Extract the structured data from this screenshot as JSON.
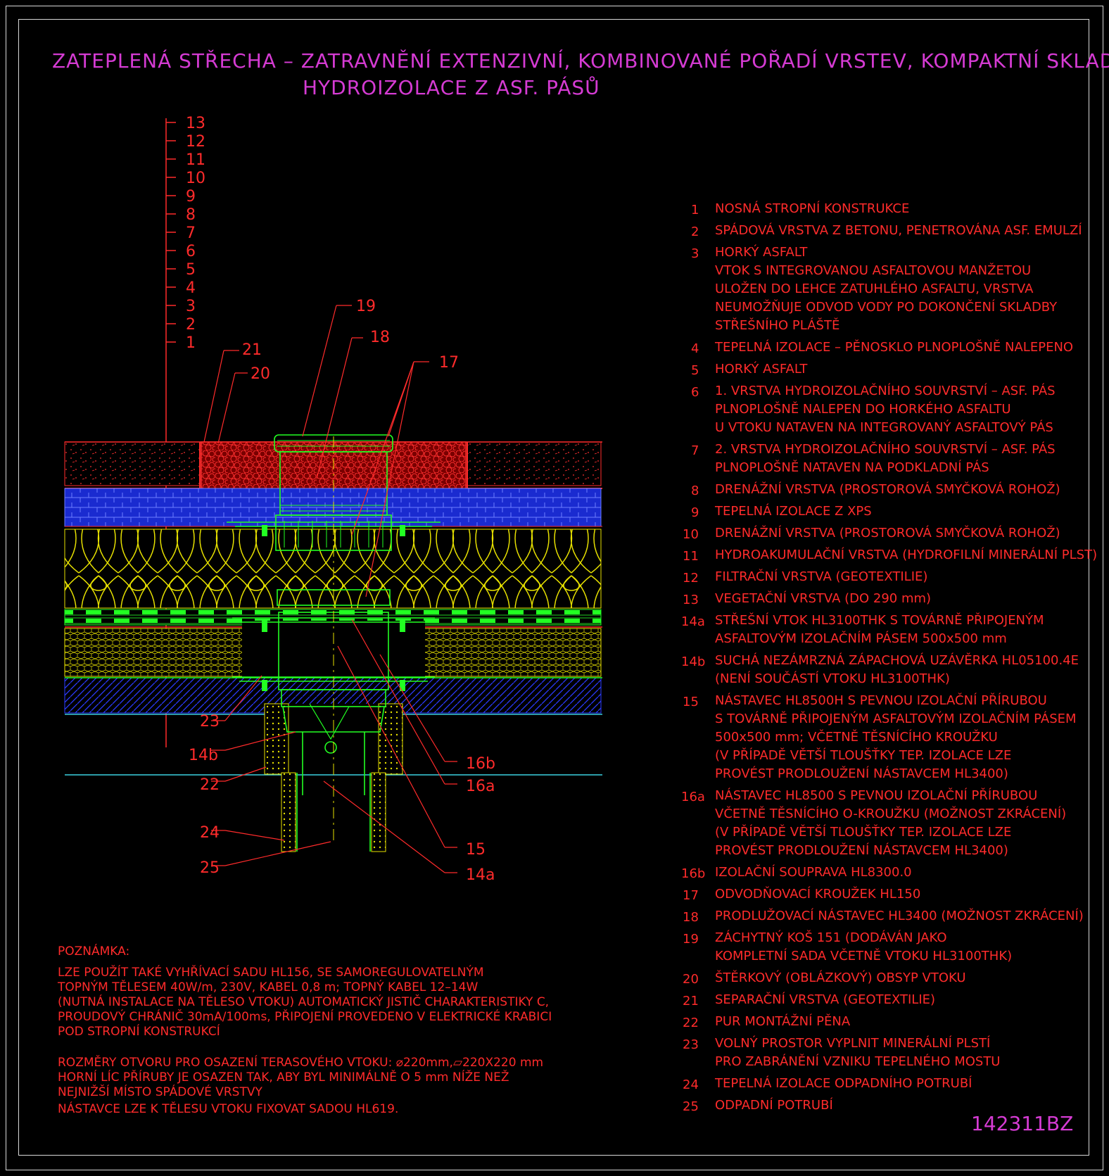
{
  "title": {
    "line1": "ZATEPLENÁ STŘECHA – ZATRAVNĚNÍ EXTENZIVNÍ, KOMBINOVANÉ POŘADÍ VRSTEV, KOMPAKTNÍ SKLADBA",
    "line2": "HYDROIZOLACE Z ASF. PÁSŮ"
  },
  "scale_labels": [
    "13",
    "12",
    "11",
    "10",
    "9",
    "8",
    "7",
    "6",
    "5",
    "4",
    "3",
    "2",
    "1"
  ],
  "callouts": {
    "c19": "19",
    "c18": "18",
    "c17": "17",
    "c21": "21",
    "c20": "20",
    "c23": "23",
    "c14b": "14b",
    "c22": "22",
    "c24": "24",
    "c25": "25",
    "c16b": "16b",
    "c16a": "16a",
    "c15": "15",
    "c14a": "14a"
  },
  "legend": [
    {
      "num": "1",
      "lines": [
        "NOSNÁ STROPNÍ KONSTRUKCE"
      ]
    },
    {
      "num": "2",
      "lines": [
        "SPÁDOVÁ VRSTVA Z BETONU, PENETROVÁNA ASF. EMULZÍ"
      ]
    },
    {
      "num": "3",
      "lines": [
        "HORKÝ ASFALT",
        "VTOK S INTEGROVANOU ASFALTOVOU MANŽETOU",
        "ULOŽEN DO LEHCE ZATUHLÉHO ASFALTU, VRSTVA",
        "NEUMOŽŇUJE ODVOD VODY PO DOKONČENÍ SKLADBY",
        "STŘEŠNÍHO PLÁŠTĚ"
      ]
    },
    {
      "num": "4",
      "lines": [
        "TEPELNÁ IZOLACE – PĚNOSKLO PLNOPLOŠNĚ NALEPENO"
      ]
    },
    {
      "num": "5",
      "lines": [
        "HORKÝ ASFALT"
      ]
    },
    {
      "num": "6",
      "lines": [
        "1. VRSTVA HYDROIZOLAČNÍHO SOUVRSTVÍ – ASF. PÁS",
        "PLNOPLOŠNĚ NALEPEN DO HORKÉHO ASFALTU",
        "U VTOKU NATAVEN NA INTEGROVANÝ ASFALTOVÝ PÁS"
      ]
    },
    {
      "num": "7",
      "lines": [
        "2. VRSTVA HYDROIZOLAČNÍHO SOUVRSTVÍ – ASF. PÁS",
        "PLNOPLOŠNĚ NATAVEN NA PODKLADNÍ PÁS"
      ]
    },
    {
      "num": "8",
      "lines": [
        "DRENÁŽNÍ VRSTVA (PROSTOROVÁ SMYČKOVÁ ROHOŽ)"
      ]
    },
    {
      "num": "9",
      "lines": [
        "TEPELNÁ IZOLACE Z XPS"
      ]
    },
    {
      "num": "10",
      "lines": [
        "DRENÁŽNÍ VRSTVA (PROSTOROVÁ SMYČKOVÁ ROHOŽ)"
      ]
    },
    {
      "num": "11",
      "lines": [
        "HYDROAKUMULAČNÍ VRSTVA (HYDROFILNÍ MINERÁLNÍ PLST)"
      ]
    },
    {
      "num": "12",
      "lines": [
        "FILTRAČNÍ VRSTVA (GEOTEXTILIE)"
      ]
    },
    {
      "num": "13",
      "lines": [
        "VEGETAČNÍ VRSTVA (DO 290 mm)"
      ]
    },
    {
      "num": "14a",
      "lines": [
        "STŘEŠNÍ VTOK HL3100THK S TOVÁRNĚ PŘIPOJENÝM",
        "ASFALTOVÝM IZOLAČNÍM PÁSEM 500x500 mm"
      ]
    },
    {
      "num": "14b",
      "lines": [
        "SUCHÁ NEZÁMRZNÁ ZÁPACHOVÁ UZÁVĚRKA HL05100.4E",
        "(NENÍ SOUČÁSTÍ VTOKU HL3100THK)"
      ]
    },
    {
      "num": "15",
      "lines": [
        "NÁSTAVEC HL8500H S PEVNOU IZOLAČNÍ PŘÍRUBOU",
        "S TOVÁRNĚ PŘIPOJENÝM ASFALTOVÝM IZOLAČNÍM PÁSEM",
        "500x500 mm; VČETNĚ TĚSNÍCÍHO KROUŽKU",
        "(V PŘÍPADĚ VĚTŠÍ TLOUŠŤKY TEP. IZOLACE LZE",
        "PROVÉST PRODLOUŽENÍ NÁSTAVCEM HL3400)"
      ]
    },
    {
      "num": "16a",
      "lines": [
        "NÁSTAVEC HL8500 S PEVNOU IZOLAČNÍ PŘÍRUBOU",
        "VČETNĚ TĚSNÍCÍHO O-KROUŽKU (MOŽNOST ZKRÁCENÍ)",
        "(V PŘÍPADĚ VĚTŠÍ TLOUŠŤKY TEP. IZOLACE LZE",
        "PROVÉST PRODLOUŽENÍ NÁSTAVCEM HL3400)"
      ]
    },
    {
      "num": "16b",
      "lines": [
        "IZOLAČNÍ SOUPRAVA HL8300.0"
      ]
    },
    {
      "num": "17",
      "lines": [
        "ODVODŇOVACÍ KROUŽEK HL150"
      ]
    },
    {
      "num": "18",
      "lines": [
        "PRODLUŽOVACÍ NÁSTAVEC HL3400 (MOŽNOST ZKRÁCENÍ)"
      ]
    },
    {
      "num": "19",
      "lines": [
        "ZÁCHYTNÝ KOŠ 151 (DODÁVÁN JAKO",
        "KOMPLETNÍ SADA VČETNĚ VTOKU HL3100THK)"
      ]
    },
    {
      "num": "20",
      "lines": [
        "ŠTĚRKOVÝ (OBLÁZKOVÝ) OBSYP VTOKU"
      ]
    },
    {
      "num": "21",
      "lines": [
        "SEPARAČNÍ VRSTVA (GEOTEXTILIE)"
      ]
    },
    {
      "num": "22",
      "lines": [
        "PUR MONTÁŽNÍ PĚNA"
      ]
    },
    {
      "num": "23",
      "lines": [
        "VOLNÝ PROSTOR VYPLNIT MINERÁLNÍ PLSTÍ",
        "PRO ZABRÁNĚNÍ VZNIKU TEPELNÉHO MOSTU"
      ]
    },
    {
      "num": "24",
      "lines": [
        "TEPELNÁ IZOLACE ODPADNÍHO POTRUBÍ"
      ]
    },
    {
      "num": "25",
      "lines": [
        "ODPADNÍ POTRUBÍ"
      ]
    }
  ],
  "note": {
    "heading": "POZNÁMKA:",
    "para1": [
      "LZE POUŽÍT TAKÉ VYHŘÍVACÍ SADU HL156, SE SAMOREGULOVATELNÝM",
      "TOPNÝM TĚLESEM 40W/m, 230V, KABEL 0,8 m; TOPNÝ KABEL 12–14W",
      "(NUTNÁ INSTALACE NA TĚLESO VTOKU) AUTOMATICKÝ JISTIČ CHARAKTERISTIKY C,",
      "PROUDOVÝ CHRÁNIČ 30mA/100ms, PŘIPOJENÍ PROVEDENO V ELEKTRICKÉ KRABICI",
      "POD STROPNÍ KONSTRUKCÍ"
    ],
    "para2": [
      "ROZMĚRY OTVORU PRO OSAZENÍ TERASOVÉHO VTOKU: ⌀220mm,▱220X220 mm",
      "HORNÍ LÍC PŘÍRUBY JE OSAZEN TAK, ABY BYL MINIMÁLNĚ O 5 mm NÍŽE NEŽ",
      "NEJNIŽŠÍ MÍSTO SPÁDOVÉ VRSTVY"
    ],
    "para3": [
      "NÁSTAVCE LZE K TĚLESU VTOKU FIXOVAT SADOU HL619."
    ]
  },
  "drawing_code": "142311BZ",
  "colors": {
    "background": "#000000",
    "frame": "#d8d8d8",
    "title": "#d53bd3",
    "text_red": "#ff2b2b",
    "xps_blue": "#1a2bd0",
    "insulation_yellow": "#e6e000",
    "drain_green": "#22ff22",
    "gravel_red": "#e02020",
    "cyan_line": "#3ad0e0"
  }
}
